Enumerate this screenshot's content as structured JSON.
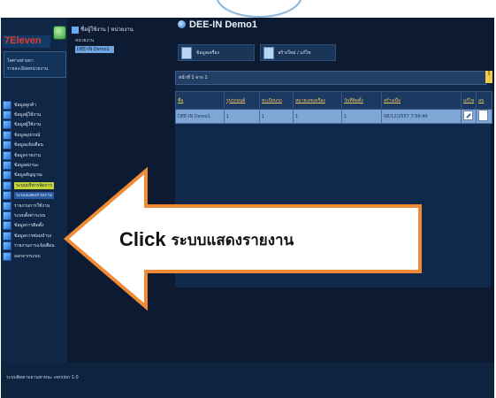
{
  "sidebar": {
    "logo_text": "7Eleven",
    "user_line1": "ไพศาลพ่ายยา",
    "user_line2": "รายละเอียดหน่วยงาน",
    "menu": [
      "ข้อมูลลูกค้า",
      "ข้อมูลผู้ใช้งาน",
      "ข้อมูลผู้ใช้งาน",
      "ข้อมูลอุปกรณ์",
      "ข้อมูลแจ้งเตือน",
      "ข้อมูลรายงาน",
      "ข้อมูลสถานะ",
      "ข้อมูลสัญญาณ",
      "ระบบบริหารจัดการ",
      "ระบบแสดงรายงาน",
      "รายงานการใช้งาน",
      "ระบบตั้งค่าระบบ",
      "ข้อมูลการติดตั้ง",
      "ข้อมูลการซ่อมบำรุง",
      "รายงานการแจ้งเตือน",
      "ออกจากระบบ"
    ],
    "selected_index": 8,
    "highlight_index": 9
  },
  "header": {
    "user_label": "ชื่อผู้ใช้งาน | หน่วยงาน",
    "title": "DEE-IN Demo1",
    "info_label": "หน่วยงาน",
    "info_value": "DEE-IN Demo1"
  },
  "tabs": [
    "ข้อมูลเครื่อง",
    "สร้างใหม่ / แก้ไข"
  ],
  "grid": {
    "header_text": "หน้าที่ 1 จาก 1",
    "pin_label": "!",
    "columns": [
      "ชื่อ",
      "รุ่นรถยนต์",
      "ทะเบียนรถ",
      "หมายเลขเครื่อง",
      "วันที่ติดตั้ง",
      "สร้างเมื่อ",
      "แก้ไข",
      "ลบ"
    ],
    "rows": [
      [
        "DEE-IN Demo1",
        "1",
        "1",
        "1",
        "1",
        "08/12/2557 7:56:46"
      ]
    ]
  },
  "footer": {
    "text": "ระบบติดตามยานพาหนะ version 1.0"
  },
  "callout": {
    "bold": "Click",
    "text": "ระบบแสดงรายงาน",
    "fill": "#ffffff",
    "stroke": "#f08a34"
  }
}
